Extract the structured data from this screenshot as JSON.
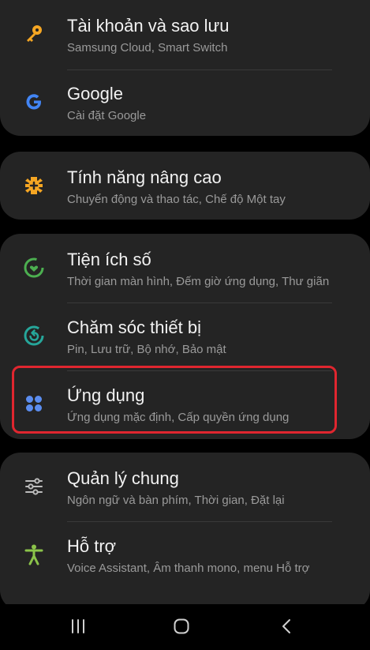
{
  "settings": {
    "items": [
      {
        "title": "Tài khoản và sao lưu",
        "subtitle": "Samsung Cloud, Smart Switch",
        "icon": "key-icon"
      },
      {
        "title": "Google",
        "subtitle": "Cài đặt Google",
        "icon": "google-icon"
      },
      {
        "title": "Tính năng nâng cao",
        "subtitle": "Chuyển động và thao tác, Chế độ Một tay",
        "icon": "advanced-features-icon"
      },
      {
        "title": "Tiện ích số",
        "subtitle": "Thời gian màn hình, Đếm giờ ứng dụng, Thư giãn",
        "icon": "digital-wellbeing-icon"
      },
      {
        "title": "Chăm sóc thiết bị",
        "subtitle": "Pin, Lưu trữ, Bộ nhớ, Bảo mật",
        "icon": "device-care-icon"
      },
      {
        "title": "Ứng dụng",
        "subtitle": "Ứng dụng mặc định, Cấp quyền ứng dụng",
        "icon": "apps-icon"
      },
      {
        "title": "Quản lý chung",
        "subtitle": "Ngôn ngữ và bàn phím, Thời gian, Đặt lại",
        "icon": "sliders-icon"
      },
      {
        "title": "Hỗ trợ",
        "subtitle": "Voice Assistant, Âm thanh mono, menu Hỗ trợ",
        "icon": "accessibility-icon"
      }
    ]
  },
  "navbar": {
    "recents_icon": "recents-icon",
    "home_icon": "home-icon",
    "back_icon": "back-icon"
  },
  "colors": {
    "background": "#000000",
    "card": "#242424",
    "title": "#f2f2f2",
    "subtitle": "#9a9a9a",
    "highlight": "#e0262f",
    "key": "#f5a623",
    "google": "#4285f4",
    "advanced": "#f5a623",
    "wellbeing": "#4caf50",
    "device_care": "#26a69a",
    "apps": "#5b8def",
    "general": "#9e9e9e",
    "accessibility": "#8bc34a"
  }
}
